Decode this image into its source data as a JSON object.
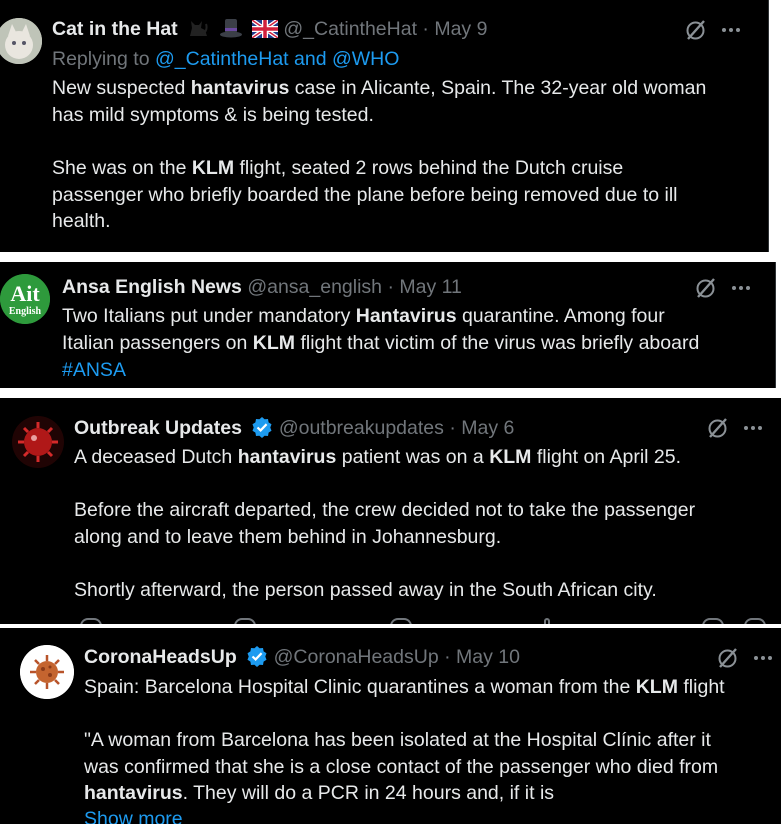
{
  "tweets": [
    {
      "author": "Cat in the Hat",
      "emojis": [
        "black-cat-icon",
        "top-hat-icon",
        "uk-flag-icon"
      ],
      "handle": "@_CatintheHat",
      "sep": "·",
      "date": "May 9",
      "reply_prefix": "Replying to ",
      "reply_targets": "@_CatintheHat and @WHO",
      "lines": [
        [
          "New suspected ",
          "hantavirus",
          " case in Alicante, Spain. The 32-year old woman"
        ],
        [
          "has mild symptoms & is being tested."
        ],
        [
          "She was on the ",
          "KLM",
          " flight, seated 2 rows behind the Dutch cruise"
        ],
        [
          "passenger who briefly boarded the plane before being removed due to ill"
        ],
        [
          "health."
        ]
      ]
    },
    {
      "author": "Ansa English News",
      "handle": "@ansa_english",
      "sep": "·",
      "date": "May 11",
      "avatar_text_top": "Ait",
      "avatar_text_bottom": "English",
      "lines": [
        [
          "Two Italians put under mandatory ",
          "Hantavirus",
          " quarantine. Among four"
        ],
        [
          "Italian passengers on ",
          "KLM",
          " flight that victim of the virus was briefly aboard"
        ]
      ],
      "hashtag": "#ANSA"
    },
    {
      "author": "Outbreak Updates",
      "handle": "@outbreakupdates",
      "sep": "·",
      "date": "May 6",
      "lines": [
        [
          "A deceased Dutch ",
          "hantavirus",
          " patient was on a ",
          "KLM",
          " flight on April 25."
        ],
        [
          "Before the aircraft departed, the crew decided not to take the passenger"
        ],
        [
          "along and to leave them behind in Johannesburg."
        ],
        [
          "Shortly afterward, the person passed away in the South African city."
        ]
      ]
    },
    {
      "author": "CoronaHeadsUp",
      "handle": "@CoronaHeadsUp",
      "sep": "·",
      "date": "May 10",
      "lines": [
        [
          "Spain: Barcelona Hospital Clinic quarantines a woman from the ",
          "KLM",
          " flight"
        ],
        [
          "\"A woman from Barcelona has been isolated at the Hospital Clínic after it"
        ],
        [
          "was confirmed that she is a close contact of the passenger who died from"
        ],
        [
          "",
          "hantavirus",
          ". They will do a PCR in 24 hours and, if it is"
        ]
      ],
      "show_more": "Show more"
    }
  ],
  "colors": {
    "background": "#000000",
    "text": "#e7e9ea",
    "secondary": "#71767b",
    "link": "#1d9bf0",
    "verified": "#1d9bf0"
  }
}
